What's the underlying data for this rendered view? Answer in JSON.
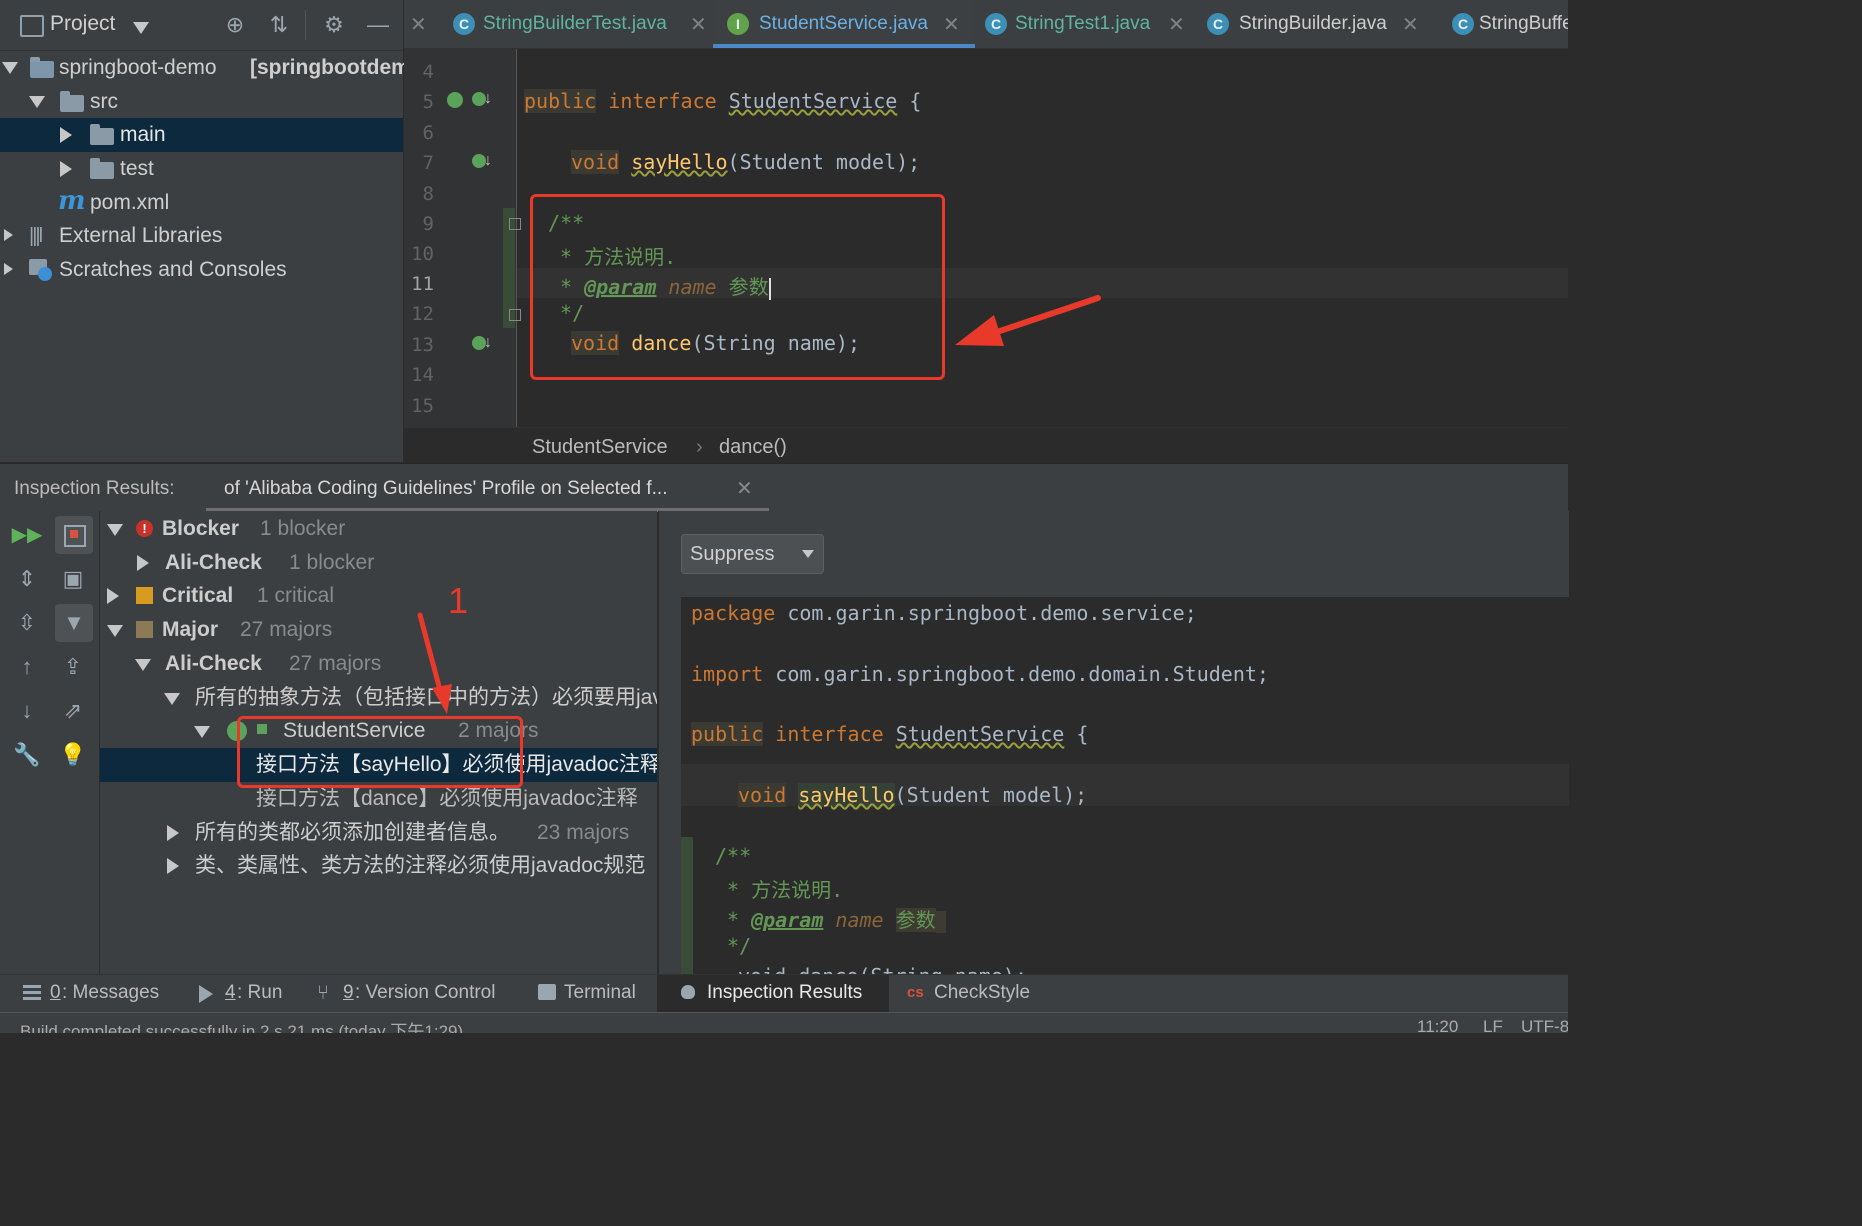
{
  "project": {
    "title": "Project",
    "tree": [
      {
        "label": "springboot-demo",
        "extra": "[springbootdemo]"
      },
      {
        "label": "src"
      },
      {
        "label": "main"
      },
      {
        "label": "test"
      },
      {
        "label": "pom.xml"
      },
      {
        "label": "External Libraries"
      },
      {
        "label": "Scratches and Consoles"
      }
    ]
  },
  "tabs": [
    {
      "label": "StringBuilderTest.java",
      "icon": "C"
    },
    {
      "label": "StudentService.java",
      "icon": "I",
      "active": true
    },
    {
      "label": "StringTest1.java",
      "icon": "C"
    },
    {
      "label": "StringBuilder.java",
      "icon": "C"
    },
    {
      "label": "StringBuffer",
      "icon": "C"
    }
  ],
  "editor": {
    "line_numbers": [
      "4",
      "5",
      "6",
      "7",
      "8",
      "9",
      "10",
      "11",
      "12",
      "13",
      "14",
      "15"
    ],
    "line5": {
      "kw1": "public",
      "kw2": "interface",
      "name": "StudentService",
      "rest": " {"
    },
    "line7": {
      "kw": "void",
      "fn": "sayHello",
      "rest": "(Student model);"
    },
    "line9": "/**",
    "line10": " * 方法说明.",
    "line11": {
      "star": " * ",
      "tag": "@param",
      "param": " name ",
      "text": "参数"
    },
    "line12": " */",
    "line13": {
      "kw": "void",
      "fn": "dance",
      "rest": "(String name);"
    },
    "breadcrumb": [
      "StudentService",
      "dance()"
    ]
  },
  "inspection": {
    "label": "Inspection Results:",
    "tab": "of 'Alibaba Coding Guidelines' Profile on Selected f...",
    "tree": {
      "blocker": {
        "label": "Blocker",
        "count": "1 blocker"
      },
      "blocker_child": {
        "label": "Ali-Check",
        "count": "1 blocker"
      },
      "critical": {
        "label": "Critical",
        "count": "1 critical"
      },
      "major": {
        "label": "Major",
        "count": "27 majors"
      },
      "major_child": {
        "label": "Ali-Check",
        "count": "27 majors"
      },
      "rule1": "所有的抽象方法（包括接口中的方法）必须要用javadoc注释",
      "class": {
        "label": "StudentService",
        "count": "2 majors"
      },
      "issue1": "接口方法【sayHello】必须使用javadoc注释",
      "issue2": "接口方法【dance】必须使用javadoc注释",
      "rule2": {
        "label": "所有的类都必须添加创建者信息。",
        "count": "23 majors"
      },
      "rule3": "类、类属性、类方法的注释必须使用javadoc规范"
    },
    "annotation": "1",
    "suppress": "Suppress",
    "preview": {
      "pkg_kw": "package",
      "pkg": " com.garin.springboot.demo.service;",
      "imp_kw": "import",
      "imp": " com.garin.springboot.demo.domain.Student;",
      "iface_kw1": "public",
      "iface_kw2": "interface",
      "iface_name": "StudentService",
      "iface_rest": " {",
      "m_kw": "void",
      "m_fn": "sayHello",
      "m_rest": "(Student model);",
      "doc1": "/**",
      "doc2": " * 方法说明.",
      "doc3_star": " * ",
      "doc3_tag": "@param",
      "doc3_param": " name ",
      "doc3_text": "参数",
      "doc4": " */",
      "last": "void dance(String name);"
    }
  },
  "bottom_tabs": [
    {
      "num": "0",
      "label": ": Messages"
    },
    {
      "num": "4",
      "label": ": Run"
    },
    {
      "num": "9",
      "label": ": Version Control"
    },
    {
      "num": "",
      "label": "Terminal"
    },
    {
      "num": "",
      "label": "Inspection Results"
    },
    {
      "num": "",
      "label": "CheckStyle"
    }
  ],
  "status": {
    "message": "Build completed successfully in 2 s 21 ms (today 下午1:29)",
    "position": "11:20",
    "line_sep": "LF",
    "encoding": "UTF-8"
  },
  "colors": {
    "annotation_red": "#e8392b",
    "selection": "#0d293e",
    "accent": "#4a88c7"
  }
}
